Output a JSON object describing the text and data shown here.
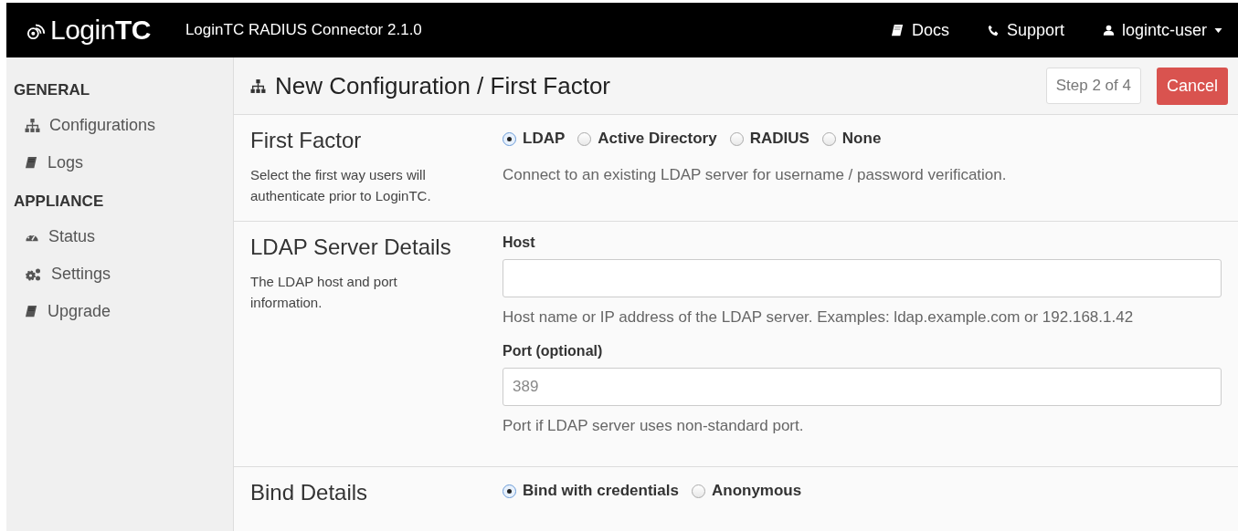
{
  "navbar": {
    "logo": "Login**TC**",
    "product": "LoginTC RADIUS Connector 2.1.0",
    "links": [
      {
        "kind": "book",
        "label": "Docs"
      },
      {
        "kind": "phone",
        "label": "Support"
      },
      {
        "kind": "user",
        "label": "logintc-user",
        "dropdown": true
      }
    ]
  },
  "sidebar": {
    "groups": [
      {
        "heading": "GENERAL",
        "items": [
          {
            "kind": "sitemap",
            "label": "Configurations"
          },
          {
            "kind": "book",
            "label": "Logs"
          }
        ]
      },
      {
        "heading": "APPLIANCE",
        "items": [
          {
            "kind": "dashboard",
            "label": "Status"
          },
          {
            "kind": "cogs",
            "label": "Settings"
          },
          {
            "kind": "book",
            "label": "Upgrade"
          }
        ]
      }
    ]
  },
  "page_header": {
    "title": "New Configuration / First Factor",
    "step": "Step 2 of 4",
    "cancel": "Cancel"
  },
  "sections": [
    {
      "title": "First Factor",
      "description": "Select the first way users will authenticate prior to LoginTC.",
      "fields": [
        {
          "kind": "radios",
          "options": [
            {
              "label": "LDAP",
              "selected": true
            },
            {
              "label": "Active Directory",
              "selected": false
            },
            {
              "label": "RADIUS",
              "selected": false
            },
            {
              "label": "None",
              "selected": false
            }
          ]
        },
        {
          "kind": "help",
          "text": "Connect to an existing LDAP server for username / password verification."
        }
      ]
    },
    {
      "title": "LDAP Server Details",
      "description": "The LDAP host and port information.",
      "fields": [
        {
          "kind": "input",
          "label": "Host",
          "help": "Host name or IP address of the LDAP server. Examples: ldap.example.com or 192.168.1.42"
        },
        {
          "kind": "input",
          "label": "Port (optional)",
          "placeholder": "389",
          "help": "Port if LDAP server uses non-standard port."
        }
      ]
    },
    {
      "title": "Bind Details",
      "fields": [
        {
          "kind": "radios",
          "options": [
            {
              "label": "Bind with credentials",
              "selected": true
            },
            {
              "label": "Anonymous",
              "selected": false
            }
          ]
        }
      ]
    }
  ]
}
